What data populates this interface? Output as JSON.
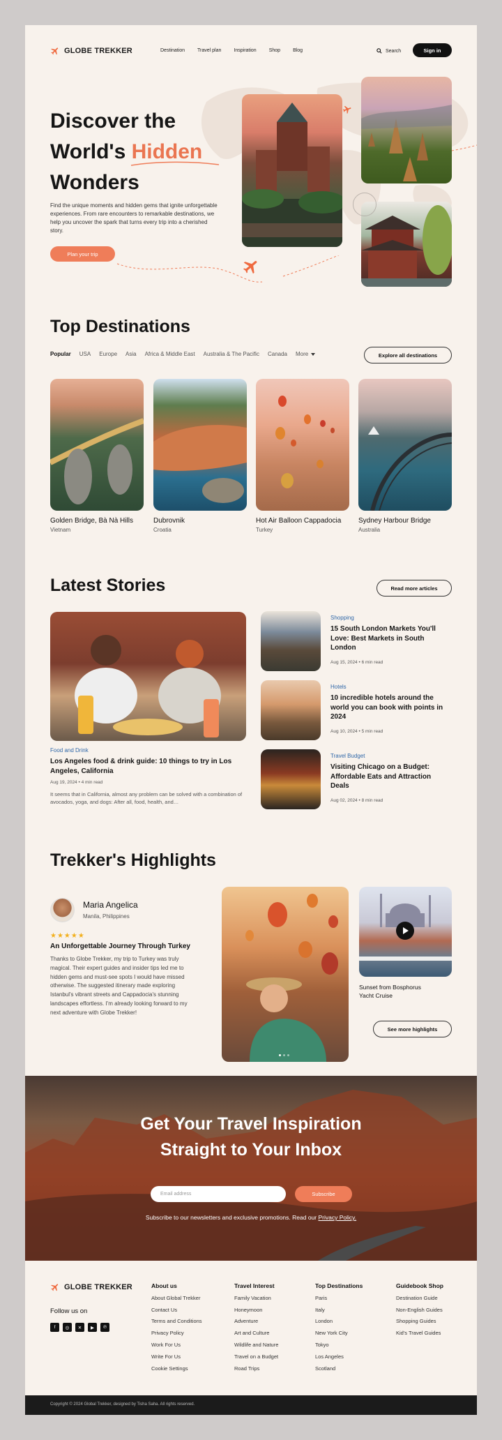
{
  "nav": {
    "brand": "GLOBE TREKKER",
    "links": [
      "Destination",
      "Travel plan",
      "Inspiration",
      "Shop",
      "Blog"
    ],
    "search_label": "Search",
    "signin_label": "Sign in"
  },
  "hero": {
    "title_line1": "Discover the",
    "title_line2a": "World's ",
    "title_line2b": "Hidden",
    "title_line3": "Wonders",
    "description": "Find the unique moments and hidden gems that ignite unforgettable experiences. From rare encounters to remarkable destinations, we help you uncover the spark that turns every trip into a cherished story.",
    "cta_label": "Plan your trip"
  },
  "destinations": {
    "title": "Top Destinations",
    "tabs": [
      "Popular",
      "USA",
      "Europe",
      "Asia",
      "Africa & Middle East",
      "Australia & The Pacific",
      "Canada",
      "More"
    ],
    "explore_label": "Explore all destinations",
    "cards": [
      {
        "name": "Golden Bridge, Bà Nà Hills",
        "country": "Vietnam"
      },
      {
        "name": "Dubrovnik",
        "country": "Croatia"
      },
      {
        "name": "Hot Air Balloon Cappadocia",
        "country": "Turkey"
      },
      {
        "name": "Sydney Harbour Bridge",
        "country": "Australia"
      }
    ]
  },
  "stories": {
    "title": "Latest Stories",
    "read_more_label": "Read more articles",
    "featured": {
      "category": "Food and Drink",
      "title": "Los Angeles food & drink guide: 10 things to try in Los Angeles, California",
      "date": "Aug 19, 2024",
      "read_time": "4 min read",
      "excerpt": "It seems that in California, almost any problem can be solved with a combination of avocados, yoga, and dogs: After all, food, health, and…"
    },
    "items": [
      {
        "category": "Shopping",
        "title": "15 South London Markets You'll Love: Best Markets in South London",
        "date": "Aug 15, 2024",
        "read_time": "6 min read"
      },
      {
        "category": "Hotels",
        "title": "10 incredible hotels around the world you can book with points in 2024",
        "date": "Aug 10, 2024",
        "read_time": "5 min read"
      },
      {
        "category": "Travel Budget",
        "title": "Visiting Chicago on a Budget: Affordable Eats and Attraction Deals",
        "date": "Aug 02, 2024",
        "read_time": "8 min read"
      }
    ]
  },
  "highlights": {
    "title": "Trekker's Highlights",
    "reviewer_name": "Maria Angelica",
    "reviewer_location": "Manila, Philippines",
    "stars": "★★★★★",
    "rating": 5,
    "review_title": "An Unforgettable Journey Through Turkey",
    "review_body": "Thanks to Globe Trekker, my trip to Turkey was truly magical. Their expert guides and insider tips led me to hidden gems and must-see spots I would have missed otherwise. The suggested itinerary made exploring Istanbul's vibrant streets and Cappadocia's stunning landscapes effortless. I'm already looking forward to my next adventure with Globe Trekker!",
    "video_caption": "Sunset from Bosphorus Yacht Cruise",
    "see_more_label": "See more highlights"
  },
  "newsletter": {
    "title_line1": "Get Your Travel Inspiration",
    "title_line2": "Straight to Your Inbox",
    "email_placeholder": "Email address",
    "subscribe_label": "Subscribe",
    "note": "Subscribe to our newsletters and exclusive promotions. Read our ",
    "note_link": "Privacy Policy."
  },
  "footer": {
    "brand": "GLOBE TREKKER",
    "follow_label": "Follow us on",
    "columns": [
      {
        "title": "About us",
        "links": [
          "About Global Trekker",
          "Contact Us",
          "Terms and Conditions",
          "Privacy Policy",
          "Work For Us",
          "Write For Us",
          "Cookie Settings"
        ]
      },
      {
        "title": "Travel Interest",
        "links": [
          "Family Vacation",
          "Honeymoon",
          "Adventure",
          "Art and Culture",
          "Wildlife and Nature",
          "Travel on a Budget",
          "Road Trips"
        ]
      },
      {
        "title": "Top Destinations",
        "links": [
          "Paris",
          "Italy",
          "London",
          "New York City",
          "Tokyo",
          "Los Angeles",
          "Scotland"
        ]
      },
      {
        "title": "Guidebook Shop",
        "links": [
          "Destination Guide",
          "Non-English Guides",
          "Shopping Guides",
          "Kid's Travel Guides"
        ]
      }
    ],
    "copyright": "Copyright © 2024 Global Trekker, designed by Tisha Saha. All rights reserved."
  },
  "colors": {
    "accent": "#ef7d59",
    "page_bg": "#f8f2ec",
    "link_blue": "#2f67a8",
    "dark": "#111111"
  },
  "icons": [
    "plane-icon",
    "search-icon",
    "chevron-down-icon",
    "play-icon",
    "facebook-icon",
    "instagram-icon",
    "x-icon",
    "youtube-icon",
    "pinterest-icon"
  ]
}
